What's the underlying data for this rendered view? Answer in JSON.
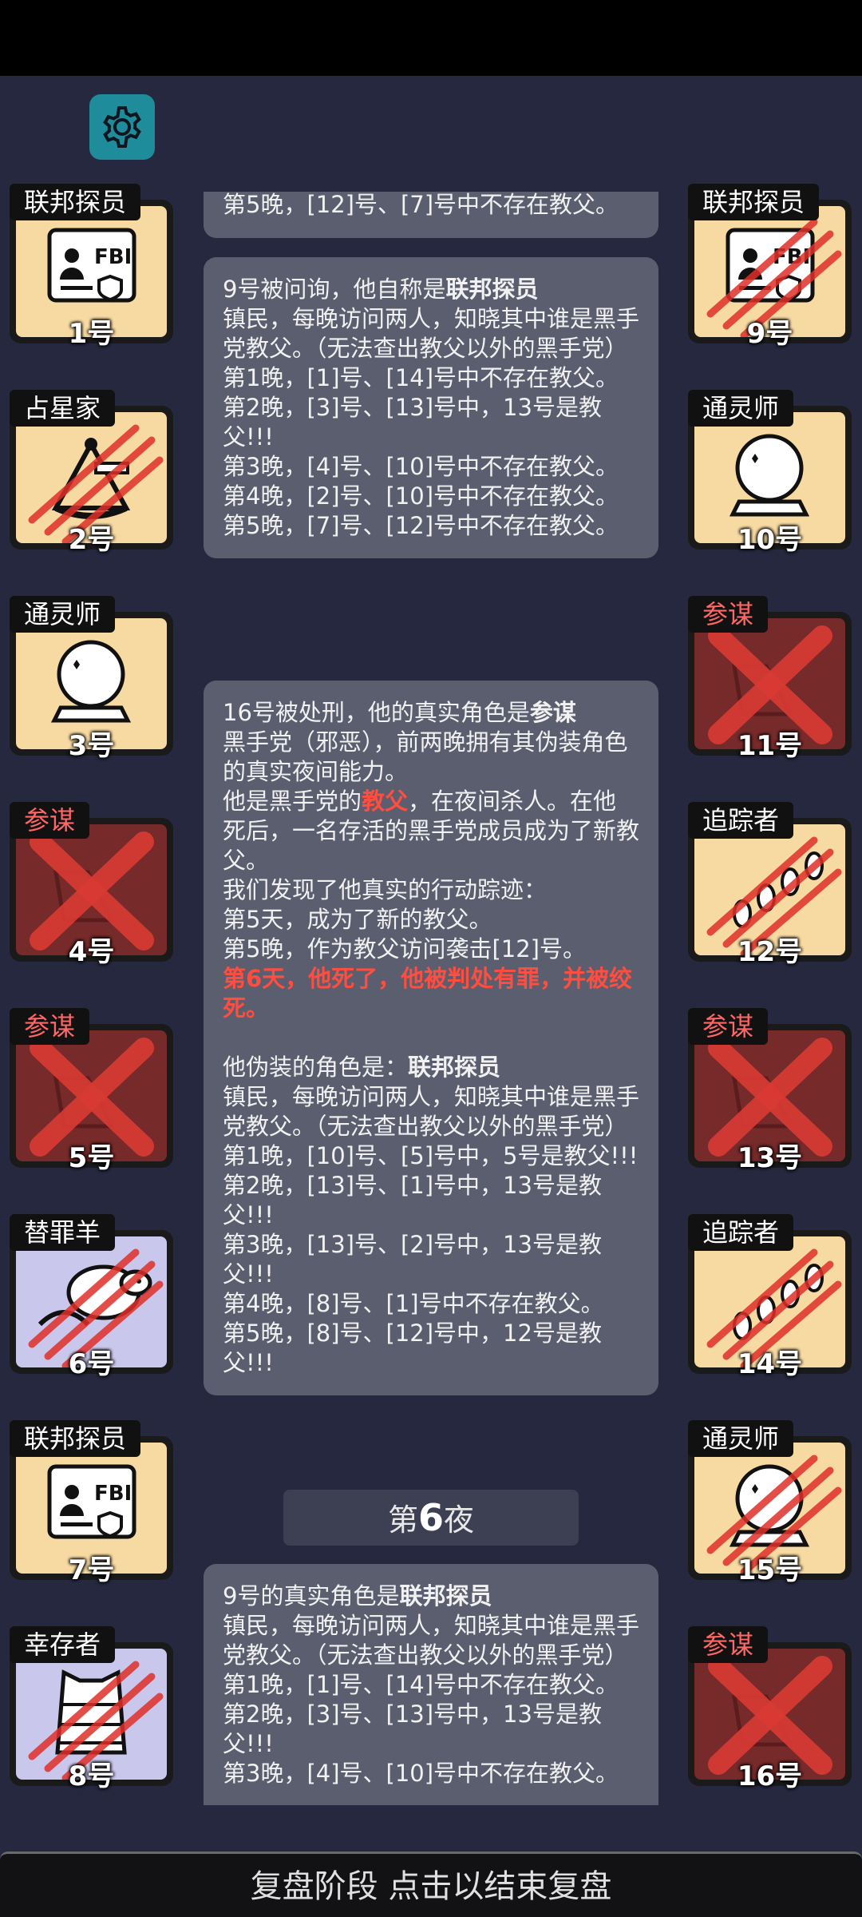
{
  "settings_button": {
    "icon": "gear-icon"
  },
  "left_cards": [
    {
      "role": "联邦探员",
      "num": "1号",
      "bg": "yellow",
      "icon": "fbi-badge-icon",
      "slashed": false,
      "dead": false
    },
    {
      "role": "占星家",
      "num": "2号",
      "bg": "yellow",
      "icon": "sextant-icon",
      "slashed": true,
      "dead": false
    },
    {
      "role": "通灵师",
      "num": "3号",
      "bg": "yellow",
      "icon": "crystal-ball-icon",
      "slashed": false,
      "dead": false
    },
    {
      "role": "参谋",
      "num": "4号",
      "bg": "red",
      "icon": "crossed-x-icon",
      "slashed": false,
      "dead": true
    },
    {
      "role": "参谋",
      "num": "5号",
      "bg": "red",
      "icon": "crossed-x-icon",
      "slashed": false,
      "dead": true
    },
    {
      "role": "替罪羊",
      "num": "6号",
      "bg": "lav",
      "icon": "sheep-icon",
      "slashed": true,
      "dead": false
    },
    {
      "role": "联邦探员",
      "num": "7号",
      "bg": "yellow",
      "icon": "fbi-badge-icon",
      "slashed": false,
      "dead": false
    },
    {
      "role": "幸存者",
      "num": "8号",
      "bg": "lav",
      "icon": "vest-icon",
      "slashed": true,
      "dead": false
    }
  ],
  "right_cards": [
    {
      "role": "联邦探员",
      "num": "9号",
      "bg": "yellow",
      "icon": "fbi-badge-icon",
      "slashed": true,
      "dead": false
    },
    {
      "role": "通灵师",
      "num": "10号",
      "bg": "yellow",
      "icon": "crystal-ball-icon",
      "slashed": false,
      "dead": false
    },
    {
      "role": "参谋",
      "num": "11号",
      "bg": "red",
      "icon": "crossed-x-icon",
      "slashed": false,
      "dead": true
    },
    {
      "role": "追踪者",
      "num": "12号",
      "bg": "yellow",
      "icon": "footprints-icon",
      "slashed": true,
      "dead": false
    },
    {
      "role": "参谋",
      "num": "13号",
      "bg": "red",
      "icon": "crossed-x-icon",
      "slashed": false,
      "dead": true
    },
    {
      "role": "追踪者",
      "num": "14号",
      "bg": "yellow",
      "icon": "footprints-icon",
      "slashed": true,
      "dead": false
    },
    {
      "role": "通灵师",
      "num": "15号",
      "bg": "yellow",
      "icon": "crystal-ball-icon",
      "slashed": true,
      "dead": false
    },
    {
      "role": "参谋",
      "num": "16号",
      "bg": "red",
      "icon": "crossed-x-icon",
      "slashed": false,
      "dead": true
    }
  ],
  "feed": {
    "msg0": {
      "line": "第5晚，[12]号、[7]号中不存在教父。"
    },
    "msg1": {
      "intro": "9号被问询，他自称是",
      "role": "联邦探员",
      "desc": "镇民，每晚访问两人，知晓其中谁是黑手党教父。（无法查出教父以外的黑手党）",
      "lines": [
        "第1晚，[1]号、[14]号中不存在教父。",
        "第2晚，[3]号、[13]号中，13号是教父!!!",
        "第3晚，[4]号、[10]号中不存在教父。",
        "第4晚，[2]号、[10]号中不存在教父。",
        "第5晚，[7]号、[12]号中不存在教父。"
      ]
    },
    "msg2": {
      "intro": "16号被处刑，他的真实角色是",
      "role": "参谋",
      "desc": "黑手党（邪恶），前两晚拥有其伪装角色的真实夜间能力。",
      "godfather_pre": "他是黑手党的",
      "godfather_word": "教父",
      "godfather_post": "，在夜间杀人。在他死后，一名存活的黑手党成员成为了新教父。",
      "trace_intro": "我们发现了他真实的行动踪迹：",
      "trace1": "第5天，成为了新的教父。",
      "trace2": "第5晚，作为教父访问袭击[12]号。",
      "death": "第6天，他死了，他被判处有罪，并被绞死。",
      "disguise_intro": "他伪装的角色是：",
      "disguise_role": "联邦探员",
      "disguise_desc": "镇民，每晚访问两人，知晓其中谁是黑手党教父。（无法查出教父以外的黑手党）",
      "lines": [
        "第1晚，[10]号、[5]号中，5号是教父!!!",
        "第2晚，[13]号、[1]号中，13号是教父!!!",
        "第3晚，[13]号、[2]号中，13号是教父!!!",
        "第4晚，[8]号、[1]号中不存在教父。",
        "第5晚，[8]号、[12]号中，12号是教父!!!"
      ]
    },
    "night": {
      "pre": "第",
      "num": "6",
      "post": "夜"
    },
    "msg3": {
      "intro": "9号的真实角色是",
      "role": "联邦探员",
      "desc": "镇民，每晚访问两人，知晓其中谁是黑手党教父。（无法查出教父以外的黑手党）",
      "lines": [
        "第1晚，[1]号、[14]号中不存在教父。",
        "第2晚，[3]号、[13]号中，13号是教父!!!",
        "第3晚，[4]号、[10]号中不存在教父。"
      ]
    }
  },
  "bottom_bar": {
    "label": "复盘阶段 点击以结束复盘"
  },
  "colors": {
    "background": "#25283f",
    "bubble": "#5b5e6e",
    "highlight": "#ff4d3f",
    "card_yellow": "#f7d9a2",
    "card_lavender": "#c9c7ec",
    "card_red": "#772a2a",
    "settings": "#1e8c9a"
  }
}
